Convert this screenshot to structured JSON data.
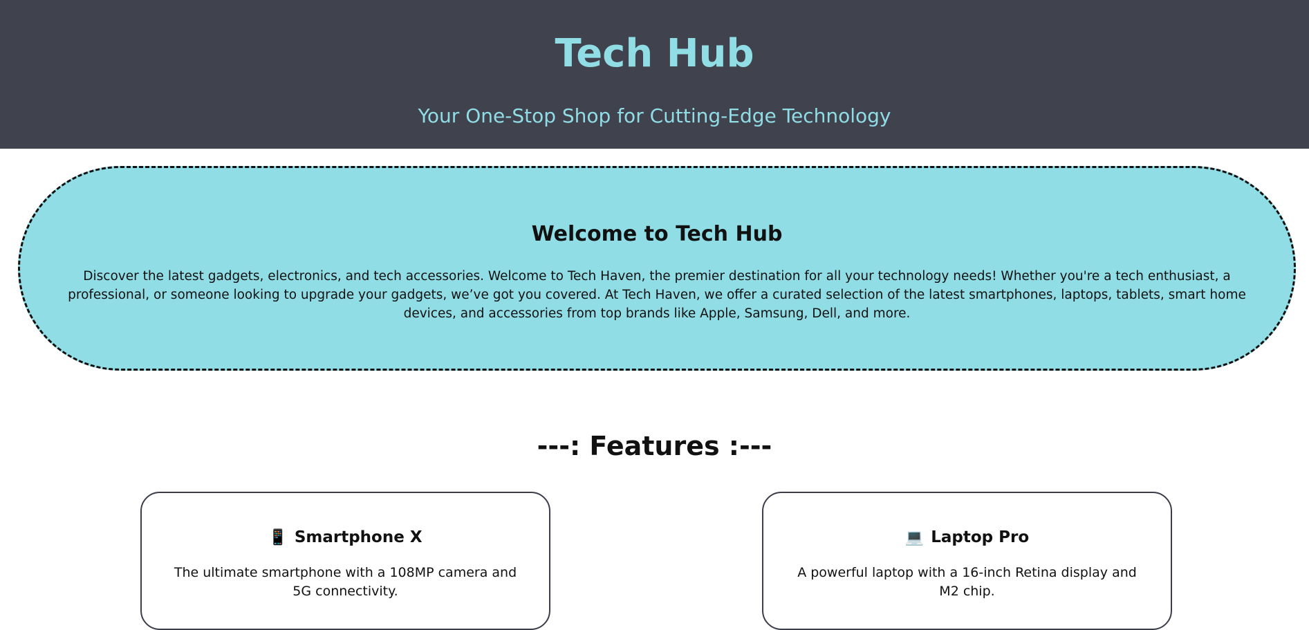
{
  "header": {
    "title": "Tech Hub",
    "tagline": "Your One-Stop Shop for Cutting-Edge Technology"
  },
  "welcome": {
    "heading": "Welcome to Tech Hub",
    "text": "Discover the latest gadgets, electronics, and tech accessories. Welcome to Tech Haven, the premier destination for all your technology needs! Whether you're a tech enthusiast, a professional, or someone looking to upgrade your gadgets, we’ve got you covered. At Tech Haven, we offer a curated selection of the latest smartphones, laptops, tablets, smart home devices, and accessories from top brands like Apple, Samsung, Dell, and more."
  },
  "features": {
    "heading": "---: Features :---",
    "cards": [
      {
        "icon": "📱",
        "icon_name": "smartphone-icon",
        "title": "Smartphone X",
        "description": "The ultimate smartphone with a 108MP camera and 5G connectivity."
      },
      {
        "icon": "💻",
        "icon_name": "laptop-icon",
        "title": "Laptop Pro",
        "description": "A powerful laptop with a 16-inch Retina display and M2 chip."
      }
    ]
  },
  "colors": {
    "header_bg": "#40424e",
    "accent": "#90dde6",
    "card_border": "#3b3d4a"
  }
}
